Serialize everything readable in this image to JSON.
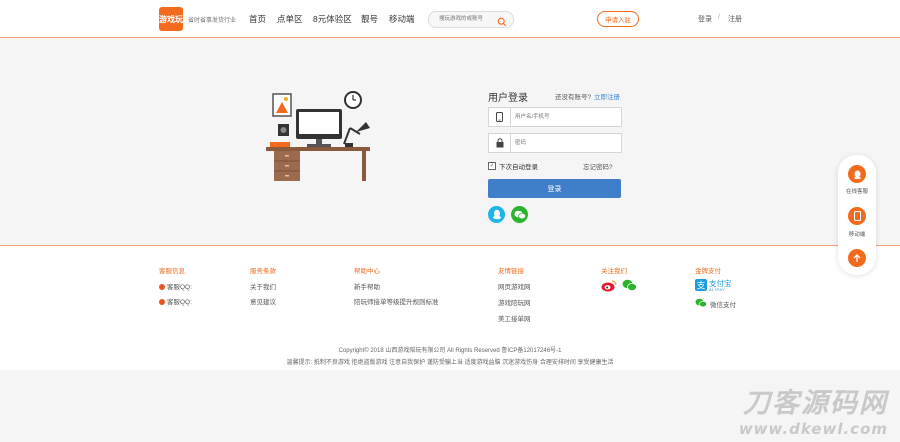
{
  "header": {
    "logo_text": "游戏玩",
    "slogan": "省时省事发货行业",
    "nav": [
      "首页",
      "点单区",
      "8元体验区",
      "靓号",
      "移动端"
    ],
    "search_placeholder": "搜玩游戏的或账号",
    "join_label": "申请入驻",
    "login_label": "登录",
    "separator": "/",
    "register_label": "注册"
  },
  "login": {
    "title": "用户登录",
    "no_account": "还没有账号?",
    "register_now": "立即注册",
    "username_placeholder": "用户名/手机号",
    "password_placeholder": "密码",
    "remember_label": "下次自动登录",
    "remember_checked": true,
    "forgot_label": "忘记密码?",
    "submit_label": "登录"
  },
  "footer": {
    "columns": [
      {
        "title": "客服信息",
        "items": [
          "客服QQ:",
          "客服QQ:"
        ]
      },
      {
        "title": "服务条款",
        "items": [
          "关于我们",
          "意见建议"
        ]
      },
      {
        "title": "帮助中心",
        "items": [
          "新手帮助",
          "陪玩师接单等级提升规则标准"
        ]
      },
      {
        "title": "友情链接",
        "items": [
          "网页游戏网",
          "游戏陪玩网",
          "美工接单网"
        ]
      },
      {
        "title": "关注我们",
        "items": []
      },
      {
        "title": "金牌支付",
        "items": [
          "支付宝",
          "ALIPAY",
          "微信支付"
        ]
      }
    ],
    "copyright": "Copyright© 2018 山西游戏陪玩有限公司 All Rights Reserved 鲁ICP备12017246号-1",
    "tips": "温馨提示: 抵制不良游戏 拒绝盗版游戏 注意自我保护 谨防受骗上当 适度游戏益脑 沉迷游戏伤身 合理安排时间 享受健康生活"
  },
  "float": {
    "service_label": "在线客服",
    "mobile_label": "移动端"
  },
  "watermark": {
    "line1": "刀客源码网",
    "line2": "www.dkewl.com"
  },
  "colors": {
    "accent": "#f26b1d",
    "primary_button": "#3f7fc9",
    "link": "#3a86d0",
    "qq": "#1eb5ea",
    "wechat": "#2bb32f",
    "weibo": "#e6162d"
  }
}
